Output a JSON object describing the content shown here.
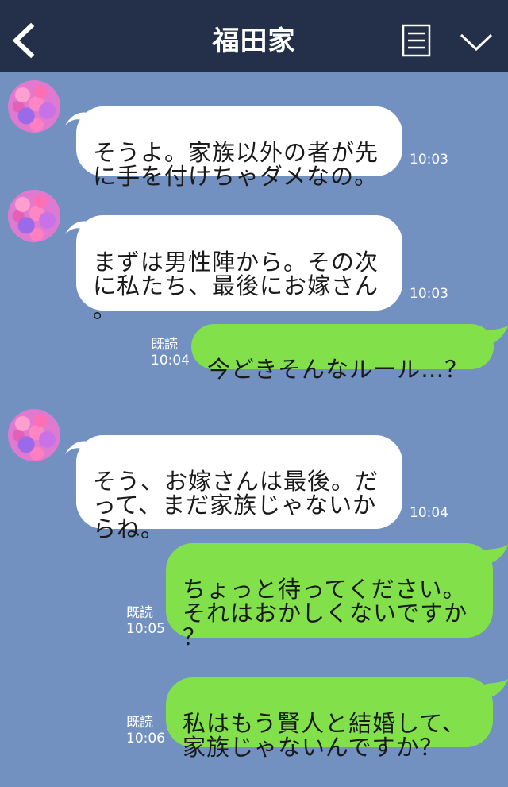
{
  "header": {
    "title": "福田家"
  },
  "messages": [
    {
      "side": "left",
      "text": "そうよ。家族以外の者が先\nに手を付けちゃダメなの。",
      "time": "10:03"
    },
    {
      "side": "left",
      "text": "まずは男性陣から。その次\nに私たち、最後にお嫁さん\n。",
      "time": "10:03"
    },
    {
      "side": "right",
      "text": "今どきそんなルール…？",
      "read": "既読",
      "time": "10:04"
    },
    {
      "side": "left",
      "text": "そう、お嫁さんは最後。だ\nって、まだ家族じゃないか\nらね。",
      "time": "10:04"
    },
    {
      "side": "right",
      "text": "ちょっと待ってください。\nそれはおかしくないですか\n？",
      "read": "既読",
      "time": "10:05"
    },
    {
      "side": "right",
      "text": "私はもう賢人と結婚して、\n家族じゃないんですか？",
      "read": "既読",
      "time": "10:06"
    }
  ],
  "colors": {
    "header_bg": "#243049",
    "chat_bg": "#7291c1",
    "bubble_left": "#ffffff",
    "bubble_right": "#82e14a"
  },
  "icons": [
    "back-chevron-icon",
    "menu-list-icon",
    "chevron-down-icon",
    "avatar-roses"
  ]
}
